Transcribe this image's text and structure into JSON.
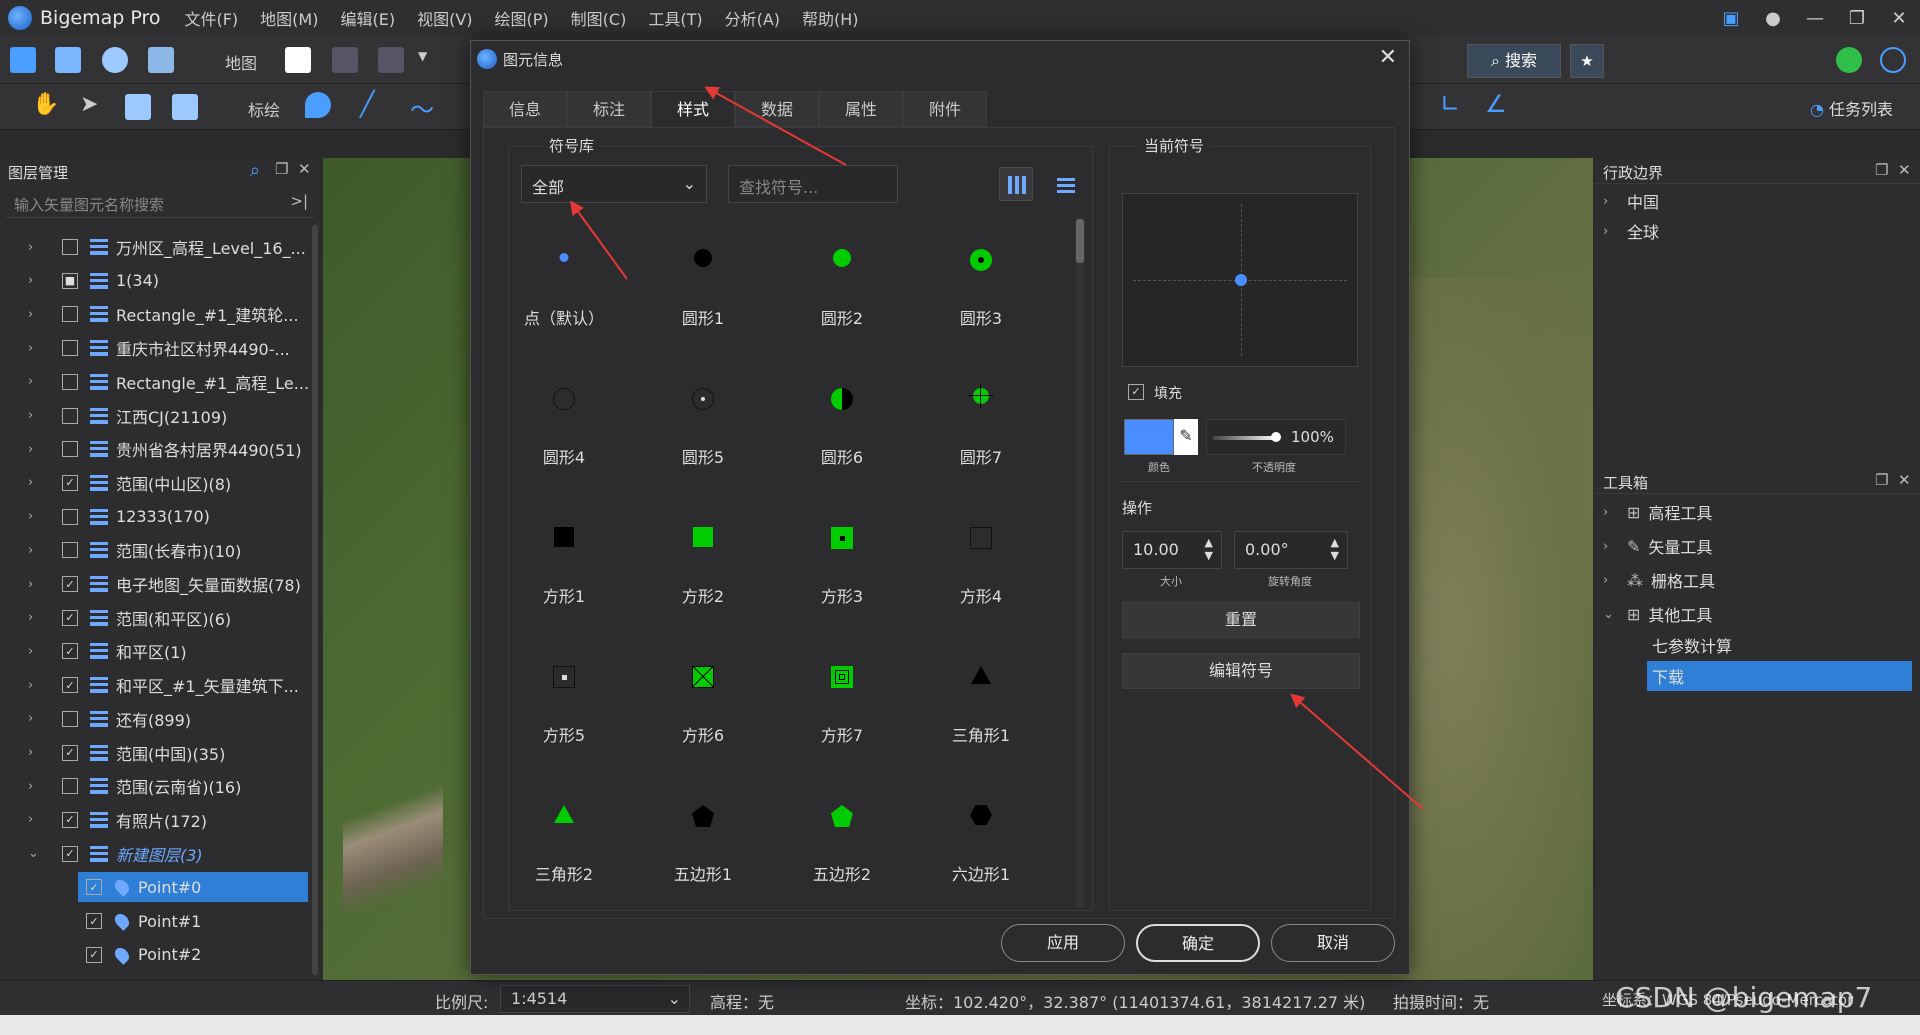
{
  "app": {
    "name": "Bigemap Pro"
  },
  "menu": [
    "文件(F)",
    "地图(M)",
    "编辑(E)",
    "视图(V)",
    "绘图(P)",
    "制图(C)",
    "工具(T)",
    "分析(A)",
    "帮助(H)"
  ],
  "toolbar1": {
    "map_label": "地图",
    "search_label": "搜索"
  },
  "toolbar2": {
    "mark_label": "标绘",
    "tasklist_label": "任务列表"
  },
  "left_panel": {
    "title": "图层管理",
    "search_placeholder": "输入矢量图元名称搜索",
    "layers": [
      {
        "name": "万州区_高程_Level_16_...",
        "checked": "unchecked"
      },
      {
        "name": "1(34)",
        "checked": "partial"
      },
      {
        "name": "Rectangle_#1_建筑轮...",
        "checked": "unchecked"
      },
      {
        "name": "重庆市社区村界4490-...",
        "checked": "unchecked"
      },
      {
        "name": "Rectangle_#1_高程_Le...",
        "checked": "unchecked"
      },
      {
        "name": "江西CJ(21109)",
        "checked": "unchecked"
      },
      {
        "name": "贵州省各村居界4490(51)",
        "checked": "unchecked"
      },
      {
        "name": "范围(中山区)(8)",
        "checked": "checked"
      },
      {
        "name": "12333(170)",
        "checked": "unchecked"
      },
      {
        "name": "范围(长春市)(10)",
        "checked": "unchecked"
      },
      {
        "name": "电子地图_矢量面数据(78)",
        "checked": "checked"
      },
      {
        "name": "范围(和平区)(6)",
        "checked": "checked"
      },
      {
        "name": "和平区(1)",
        "checked": "checked"
      },
      {
        "name": "和平区_#1_矢量建筑下...",
        "checked": "checked"
      },
      {
        "name": "还有(899)",
        "checked": "unchecked"
      },
      {
        "name": "范围(中国)(35)",
        "checked": "checked"
      },
      {
        "name": "范围(云南省)(16)",
        "checked": "unchecked"
      },
      {
        "name": "有照片(172)",
        "checked": "checked"
      },
      {
        "name": "新建图层(3)",
        "checked": "checked"
      }
    ],
    "points": [
      "Point#0",
      "Point#1",
      "Point#2"
    ]
  },
  "right_panel": {
    "admin_title": "行政边界",
    "admin_items": [
      "中国",
      "全球"
    ],
    "toolbox_title": "工具箱",
    "tools": [
      "高程工具",
      "矢量工具",
      "栅格工具",
      "其他工具"
    ],
    "other_tools": [
      "七参数计算",
      "下载"
    ]
  },
  "status": {
    "scale_label": "比例尺:",
    "scale_value": "1:4514",
    "elev": "高程：无",
    "coord": "坐标：102.420°，32.387°  (11401374.61，3814217.27 米)",
    "shot_time": "拍摄时间：无",
    "crs": "坐标系：WGS 84/Pseudo-Mercator",
    "watermark": "CSDN @bigemap7"
  },
  "dialog": {
    "title": "图元信息",
    "tabs": [
      "信息",
      "标注",
      "样式",
      "数据",
      "属性",
      "附件"
    ],
    "active_tab": "样式",
    "symbol_lib_label": "符号库",
    "category": "全部",
    "search_placeholder": "查找符号...",
    "symbols": [
      {
        "label": "点（默认）",
        "shape": "dot-small-blue"
      },
      {
        "label": "圆形1",
        "shape": "circle-black"
      },
      {
        "label": "圆形2",
        "shape": "circle-green"
      },
      {
        "label": "圆形3",
        "shape": "circle-green-ring"
      },
      {
        "label": "圆形4",
        "shape": "circle-outline"
      },
      {
        "label": "圆形5",
        "shape": "circle-outline-dot"
      },
      {
        "label": "圆形6",
        "shape": "circle-half"
      },
      {
        "label": "圆形7",
        "shape": "circle-cross"
      },
      {
        "label": "方形1",
        "shape": "square-black"
      },
      {
        "label": "方形2",
        "shape": "square-green"
      },
      {
        "label": "方形3",
        "shape": "square-green-dot"
      },
      {
        "label": "方形4",
        "shape": "square-outline"
      },
      {
        "label": "方形5",
        "shape": "square-outline-dot"
      },
      {
        "label": "方形6",
        "shape": "square-green-x"
      },
      {
        "label": "方形7",
        "shape": "square-green-nested"
      },
      {
        "label": "三角形1",
        "shape": "triangle-black"
      },
      {
        "label": "三角形2",
        "shape": "triangle-green"
      },
      {
        "label": "五边形1",
        "shape": "pentagon-black"
      },
      {
        "label": "五边形2",
        "shape": "pentagon-green"
      },
      {
        "label": "六边形1",
        "shape": "hexagon-black"
      }
    ],
    "current_symbol_label": "当前符号",
    "fill_label": "填充",
    "fill_color": "#4a8dff",
    "color_label": "颜色",
    "opacity_value": "100%",
    "opacity_level": 1.0,
    "opacity_label": "不透明度",
    "ops_label": "操作",
    "size_value": "10.00",
    "size_label": "大小",
    "rotation_value": "0.00°",
    "rotation_label": "旋转角度",
    "reset_label": "重置",
    "edit_symbol_label": "编辑符号",
    "apply_label": "应用",
    "ok_label": "确定",
    "cancel_label": "取消"
  }
}
